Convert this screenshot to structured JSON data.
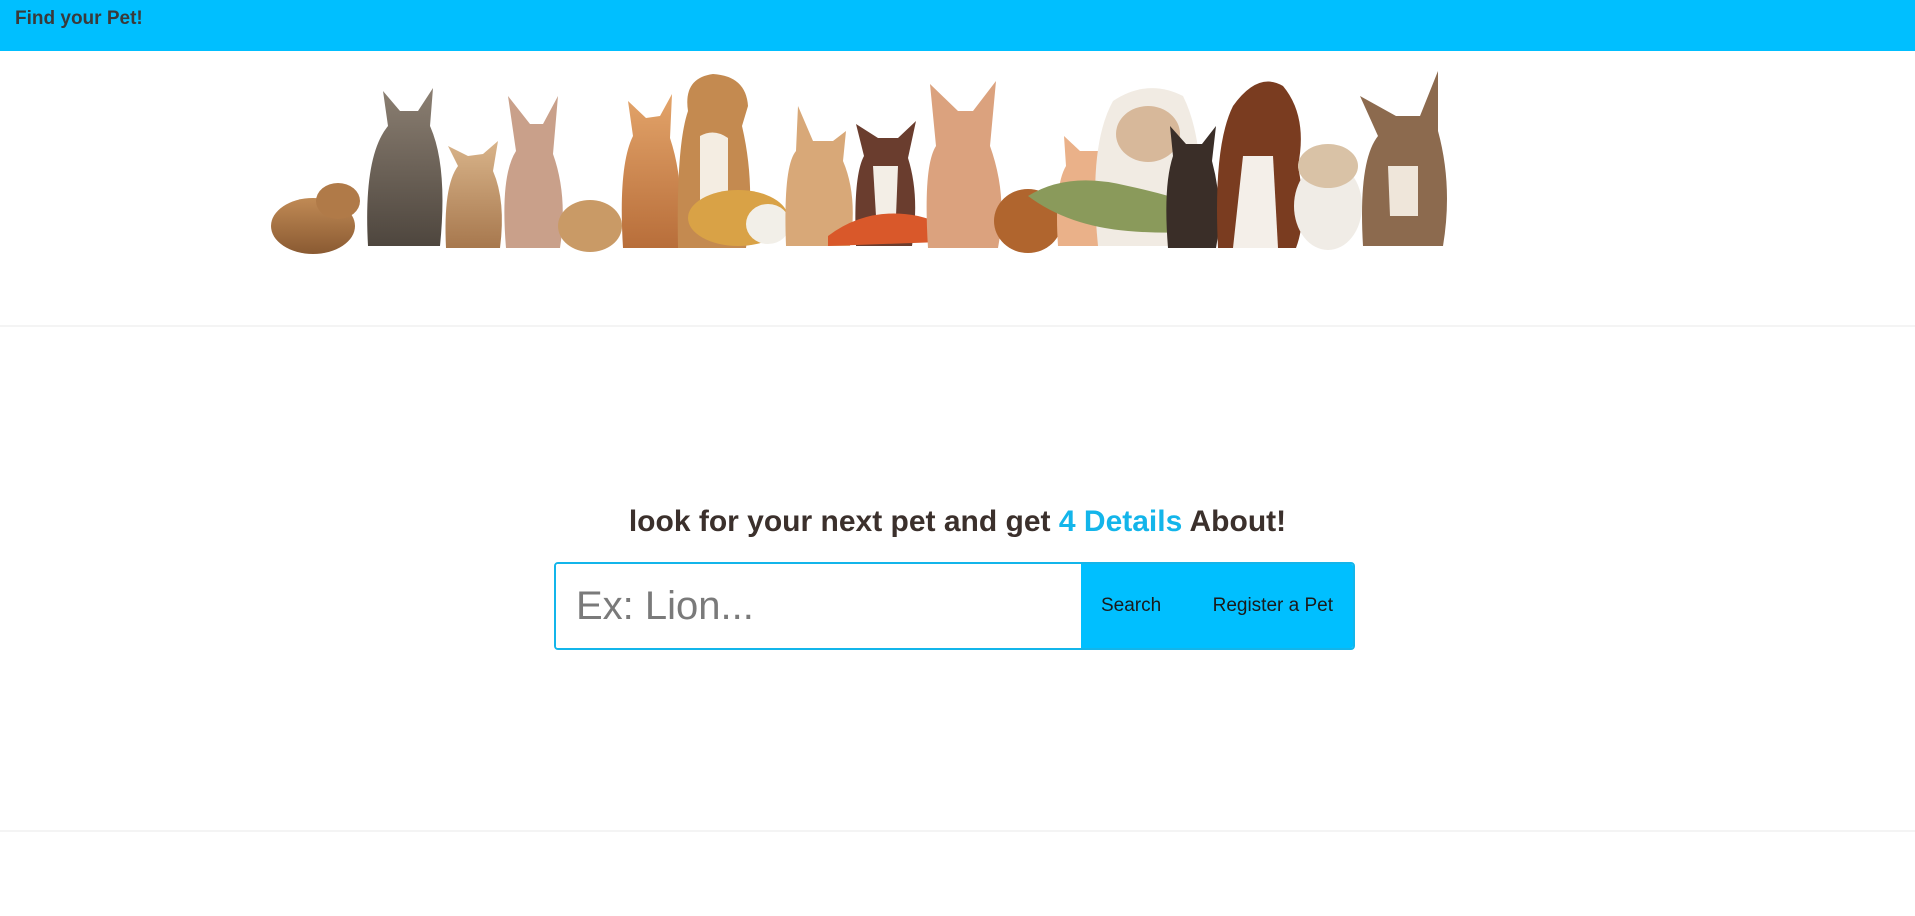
{
  "navbar": {
    "brand": "Find your Pet!"
  },
  "banner": {
    "icon": "pets-group-image",
    "description_alt": "Group of pets"
  },
  "hero": {
    "headline_prefix": "look for your next pet and get ",
    "headline_accent": "4 Details",
    "headline_suffix": " About!"
  },
  "search": {
    "placeholder": "Ex: Lion...",
    "value": "",
    "search_label": "Search",
    "register_label": "Register a Pet"
  },
  "colors": {
    "accent": "#00bfff",
    "accent_text": "#13b5ea",
    "heading": "#3b302c"
  }
}
